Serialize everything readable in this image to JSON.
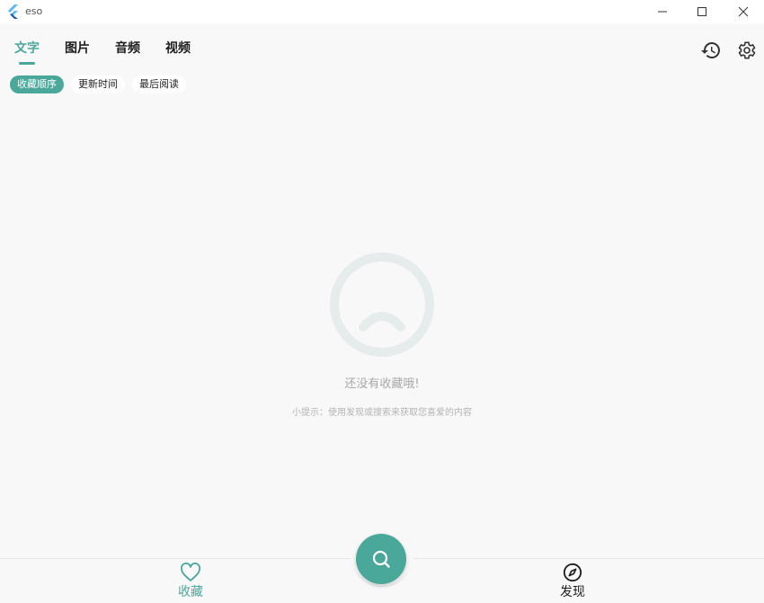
{
  "window": {
    "title": "eso",
    "minimize_icon": "minimize-icon",
    "maximize_icon": "maximize-icon",
    "close_icon": "close-icon"
  },
  "tabs": [
    {
      "label": "文字",
      "active": true
    },
    {
      "label": "图片",
      "active": false
    },
    {
      "label": "音频",
      "active": false
    },
    {
      "label": "视频",
      "active": false
    }
  ],
  "toolbar": {
    "history_icon": "history-icon",
    "settings_icon": "gear-icon"
  },
  "sort_chips": [
    {
      "label": "收藏顺序",
      "active": true
    },
    {
      "label": "更新时间",
      "active": false
    },
    {
      "label": "最后阅读",
      "active": false
    }
  ],
  "empty_state": {
    "icon": "sad-face-icon",
    "title": "还没有收藏哦!",
    "hint": "小提示：使用发现或搜索来获取您喜爱的内容"
  },
  "bottom_nav": {
    "favorites": {
      "label": "收藏",
      "icon": "heart-icon"
    },
    "search": {
      "icon": "search-icon"
    },
    "discover": {
      "label": "发现",
      "icon": "compass-icon"
    }
  },
  "colors": {
    "accent": "#4aa89b",
    "background": "#f8f8f8",
    "face": "#e6eceb"
  }
}
